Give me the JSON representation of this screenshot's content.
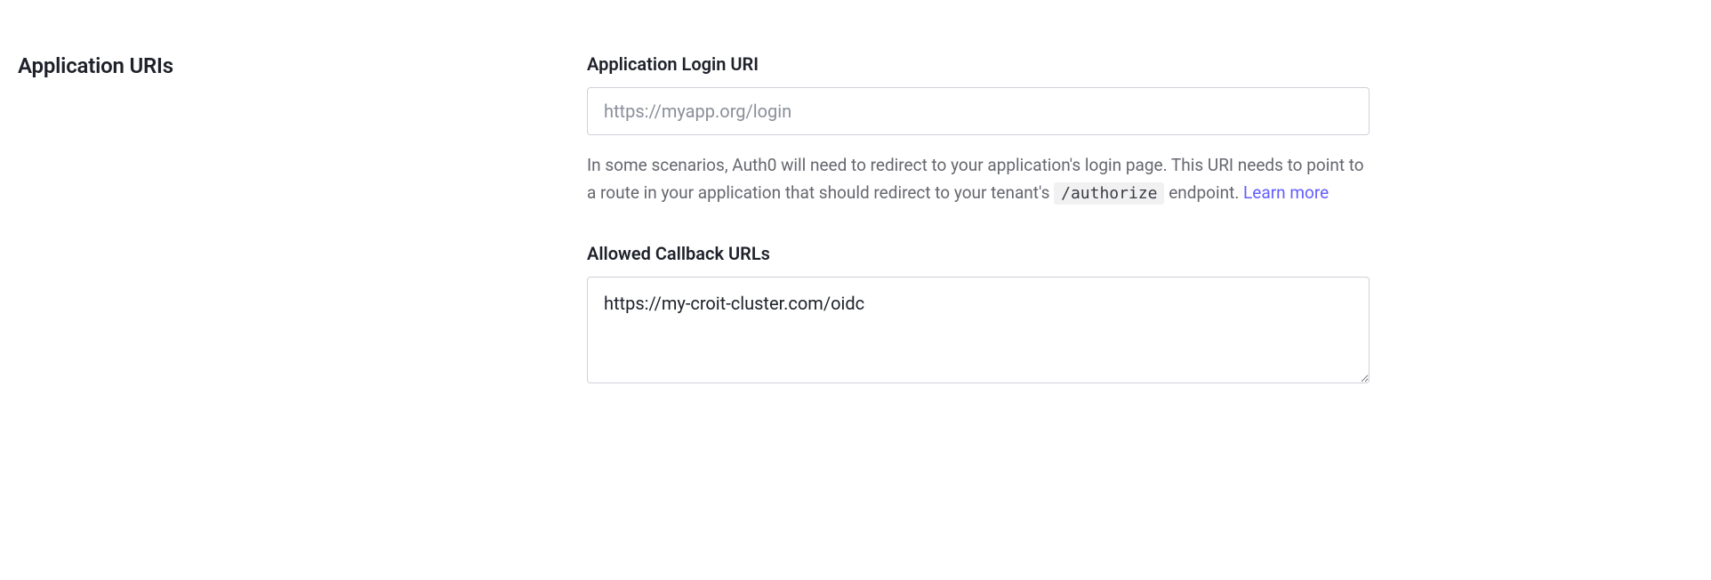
{
  "section": {
    "title": "Application URIs"
  },
  "login_uri": {
    "label": "Application Login URI",
    "placeholder": "https://myapp.org/login",
    "value": "",
    "help_before": "In some scenarios, Auth0 will need to redirect to your application's login page. This URI needs to point to a route in your application that should redirect to your tenant's ",
    "help_code": "/authorize",
    "help_after": " endpoint. ",
    "learn_more": "Learn more"
  },
  "callback_urls": {
    "label": "Allowed Callback URLs",
    "value": "https://my-croit-cluster.com/oidc"
  }
}
